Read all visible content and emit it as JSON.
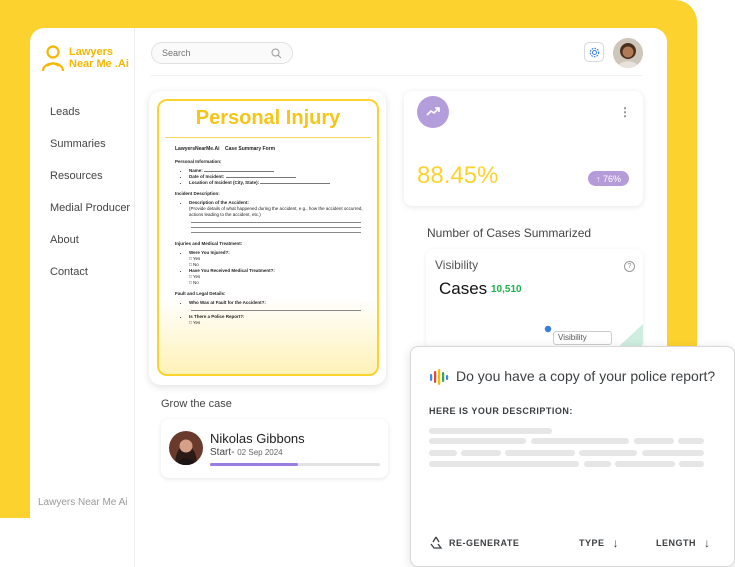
{
  "brand": {
    "name_line1": "Lawyers",
    "name_line2": "Near Me .Ai",
    "footer": "Lawyers Near Me Ai"
  },
  "colors": {
    "accent_yellow": "#FCD22F",
    "purple": "#B39DDB",
    "green": "#19B34B"
  },
  "sidebar": {
    "items": [
      {
        "label": "Leads"
      },
      {
        "label": "Summaries"
      },
      {
        "label": "Resources"
      },
      {
        "label": "Medial Producer"
      },
      {
        "label": "About"
      },
      {
        "label": "Contact"
      }
    ]
  },
  "header": {
    "search_placeholder": "Search",
    "icons": [
      "search-icon",
      "settings-icon",
      "avatar"
    ]
  },
  "document": {
    "title": "Personal Injury",
    "company": "LawyersNearMe.Ai",
    "form_title": "Case Summary Form",
    "personal_info_heading": "Personal Information:",
    "personal_info_items": [
      "Name:",
      "Date of Incident:",
      "Location of Incident (City, State):"
    ],
    "incident_heading": "Incident Description:",
    "incident_item": "Description of the Accident:",
    "incident_help": "(Provide details of what happened during the accident, e.g., how the accident occurred, actions leading to the accident, etc.)",
    "injuries_heading": "Injuries and Medical Treatment:",
    "injured_question": "Were You Injured?:",
    "medical_question": "Have You Received Medical Treatment?:",
    "opt_yes": "Yes",
    "opt_no": "No",
    "fault_heading": "Fault and Legal Details:",
    "fault_question": "Who Was at Fault for the Accident?:",
    "police_question": "Is There a Police Report?:"
  },
  "stat": {
    "percent": "88.45%",
    "badge": "76%"
  },
  "cases": {
    "section_title": "Number of Cases Summarized",
    "visibility_label": "Visibility",
    "cases_label": "Cases",
    "count": "10,510",
    "tooltip": "Visibility"
  },
  "grow": {
    "title": "Grow the case",
    "name": "Nikolas Gibbons",
    "start_label": "Start-",
    "start_date": "02 Sep 2024",
    "progress": 0.52
  },
  "assistant": {
    "question": "Do you have a copy of your police report?",
    "subheading": "HERE IS YOUR DESCRIPTION:",
    "actions": {
      "regenerate": "RE-GENERATE",
      "type": "TYPE",
      "length": "LENGTH"
    }
  }
}
